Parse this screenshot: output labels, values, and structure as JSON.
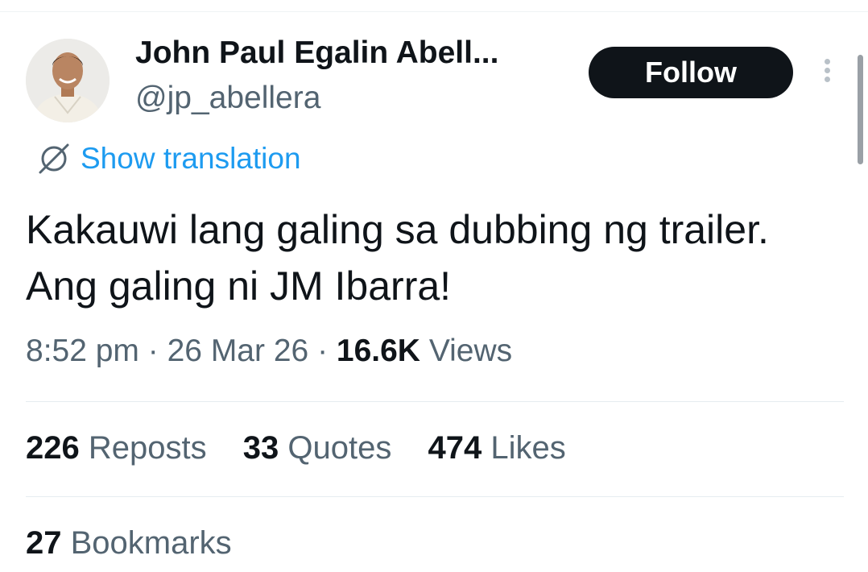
{
  "author": {
    "display_name": "John Paul Egalin Abell...",
    "handle": "@jp_abellera"
  },
  "actions": {
    "follow_label": "Follow",
    "more_icon": "more-vertical-icon"
  },
  "translation": {
    "label": "Show translation",
    "icon": "globe-icon"
  },
  "tweet": {
    "text": "Kakauwi lang galing sa dubbing ng trailer. Ang galing ni JM Ibarra!",
    "time": "8:52 pm",
    "date": "26 Mar 26",
    "separator": "·",
    "views_count": "16.6K",
    "views_label": "Views"
  },
  "stats": {
    "reposts_count": "226",
    "reposts_label": "Reposts",
    "quotes_count": "33",
    "quotes_label": "Quotes",
    "likes_count": "474",
    "likes_label": "Likes",
    "bookmarks_count": "27",
    "bookmarks_label": "Bookmarks"
  },
  "colors": {
    "text_primary": "#0f1419",
    "text_secondary": "#536471",
    "link": "#1d9bf0",
    "follow_bg": "#0f1419"
  }
}
